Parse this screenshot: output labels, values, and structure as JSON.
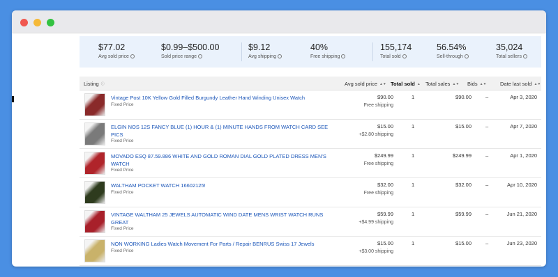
{
  "summary": [
    {
      "value": "$77.02",
      "label": "Avg sold price"
    },
    {
      "value": "$0.99–$500.00",
      "label": "Sold price range"
    },
    {
      "value": "$9.12",
      "label": "Avg shipping"
    },
    {
      "value": "40%",
      "label": "Free shipping"
    },
    {
      "value": "155,174",
      "label": "Total sold"
    },
    {
      "value": "56.54%",
      "label": "Sell-through"
    },
    {
      "value": "35,024",
      "label": "Total sellers"
    }
  ],
  "table": {
    "headers": {
      "listing": "Listing",
      "avg_sold_price": "Avg sold price",
      "total_sold": "Total sold",
      "total_sales": "Total sales",
      "bids": "Bids",
      "date_last_sold": "Date last sold"
    },
    "rows": [
      {
        "title": "Vintage Post 10K Yellow Gold Filled Burgundy Leather Hand Winding Unisex Watch",
        "format": "Fixed Price",
        "price": "$90.00",
        "shipping": "Free shipping",
        "sold": "1",
        "sales": "$90.00",
        "bids": "–",
        "date": "Apr 3, 2020",
        "thumb_color": "#8a2a2a"
      },
      {
        "title": "ELGIN NOS 12S FANCY BLUE (1) HOUR & (1) MINUTE HANDS FROM WATCH CARD SEE PICS",
        "format": "Fixed Price",
        "price": "$15.00",
        "shipping": "+$2.80 shipping",
        "sold": "1",
        "sales": "$15.00",
        "bids": "–",
        "date": "Apr 7, 2020",
        "thumb_color": "#7a7a7a"
      },
      {
        "title": "MOVADO ESQ 87.59.886 WHITE AND GOLD ROMAN DIAL GOLD PLATED DRESS MEN'S WATCH",
        "format": "Fixed Price",
        "price": "$249.99",
        "shipping": "Free shipping",
        "sold": "1",
        "sales": "$249.99",
        "bids": "–",
        "date": "Apr 1, 2020",
        "thumb_color": "#b0242a"
      },
      {
        "title": "WALTHAM POCKET WATCH 16602125!",
        "format": "Fixed Price",
        "price": "$32.00",
        "shipping": "Free shipping",
        "sold": "1",
        "sales": "$32.00",
        "bids": "–",
        "date": "Apr 10, 2020",
        "thumb_color": "#2e3b1e"
      },
      {
        "title": "VINTAGE WALTHAM 25 JEWELS AUTOMATIC WIND DATE MENS WRIST WATCH RUNS GREAT",
        "format": "Fixed Price",
        "price": "$59.99",
        "shipping": "+$4.99 shipping",
        "sold": "1",
        "sales": "$59.99",
        "bids": "–",
        "date": "Jun 21, 2020",
        "thumb_color": "#a8202a"
      },
      {
        "title": "NON WORKING Ladies Watch Movement For Parts / Repair BENRUS Swiss 17 Jewels",
        "format": "Fixed Price",
        "price": "$15.00",
        "shipping": "+$3.00 shipping",
        "sold": "1",
        "sales": "$15.00",
        "bids": "–",
        "date": "Jun 23, 2020",
        "thumb_color": "#c9b26a"
      }
    ]
  }
}
